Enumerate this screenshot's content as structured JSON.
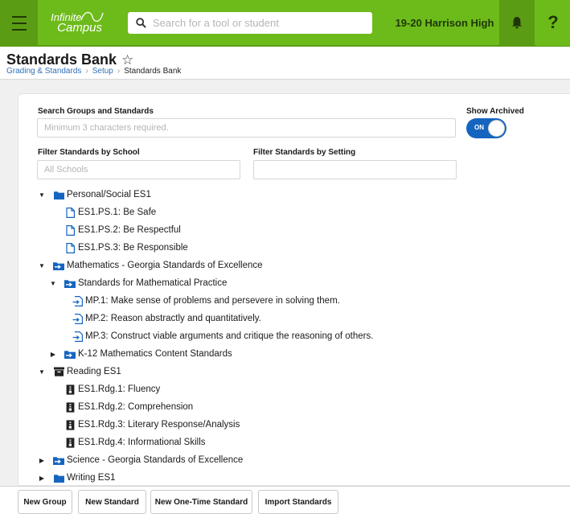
{
  "topbar": {
    "logo_line1": "Infinite",
    "logo_line2": "Campus",
    "search_placeholder": "Search for a tool or student",
    "school": "19-20 Harrison High",
    "help": "?",
    "brand_color": "#6dbb1b"
  },
  "page": {
    "title": "Standards Bank",
    "star": "☆",
    "breadcrumb": {
      "item1": "Grading & Standards",
      "item2": "Setup",
      "current": "Standards Bank",
      "sep": "›"
    }
  },
  "filters": {
    "search_label": "Search Groups and Standards",
    "search_placeholder": "Minimum 3 characters required.",
    "show_archived_label": "Show Archived",
    "toggle_on": "ON",
    "school_label": "Filter Standards by School",
    "school_placeholder": "All Schools",
    "setting_label": "Filter Standards by Setting",
    "setting_value": ""
  },
  "tree": [
    {
      "caret": "▼",
      "icon": "folder-icon",
      "label": "Personal/Social ES1"
    },
    {
      "caret": "",
      "icon": "document-icon",
      "label": "ES1.PS.1: Be Safe"
    },
    {
      "caret": "",
      "icon": "document-icon",
      "label": "ES1.PS.2: Be Respectful"
    },
    {
      "caret": "",
      "icon": "document-icon",
      "label": "ES1.PS.3: Be Responsible"
    },
    {
      "caret": "▼",
      "icon": "linked-folder-icon",
      "label": "Mathematics - Georgia Standards of Excellence"
    },
    {
      "caret": "▼",
      "icon": "linked-folder-icon",
      "label": "Standards for Mathematical Practice"
    },
    {
      "caret": "",
      "icon": "linked-document-icon",
      "label": "MP.1: Make sense of problems and persevere in solving them."
    },
    {
      "caret": "",
      "icon": "linked-document-icon",
      "label": "MP.2: Reason abstractly and quantitatively."
    },
    {
      "caret": "",
      "icon": "linked-document-icon",
      "label": "MP.3: Construct viable arguments and critique the reasoning of others."
    },
    {
      "caret": "▶",
      "icon": "linked-folder-icon",
      "label": "K-12 Mathematics Content Standards"
    },
    {
      "caret": "▼",
      "icon": "archived-folder-icon",
      "label": "Reading ES1"
    },
    {
      "caret": "",
      "icon": "archived-document-icon",
      "label": "ES1.Rdg.1: Fluency"
    },
    {
      "caret": "",
      "icon": "archived-document-icon",
      "label": "ES1.Rdg.2: Comprehension"
    },
    {
      "caret": "",
      "icon": "archived-document-icon",
      "label": "ES1.Rdg.3: Literary Response/Analysis"
    },
    {
      "caret": "",
      "icon": "archived-document-icon",
      "label": "ES1.Rdg.4: Informational Skills"
    },
    {
      "caret": "▶",
      "icon": "linked-folder-icon",
      "label": "Science - Georgia Standards of Excellence"
    },
    {
      "caret": "▶",
      "icon": "folder-icon",
      "label": "Writing ES1"
    }
  ],
  "buttons": {
    "new_group": "New Group",
    "new_standard": "New Standard",
    "new_one_time": "New One-Time Standard",
    "import": "Import Standards"
  }
}
